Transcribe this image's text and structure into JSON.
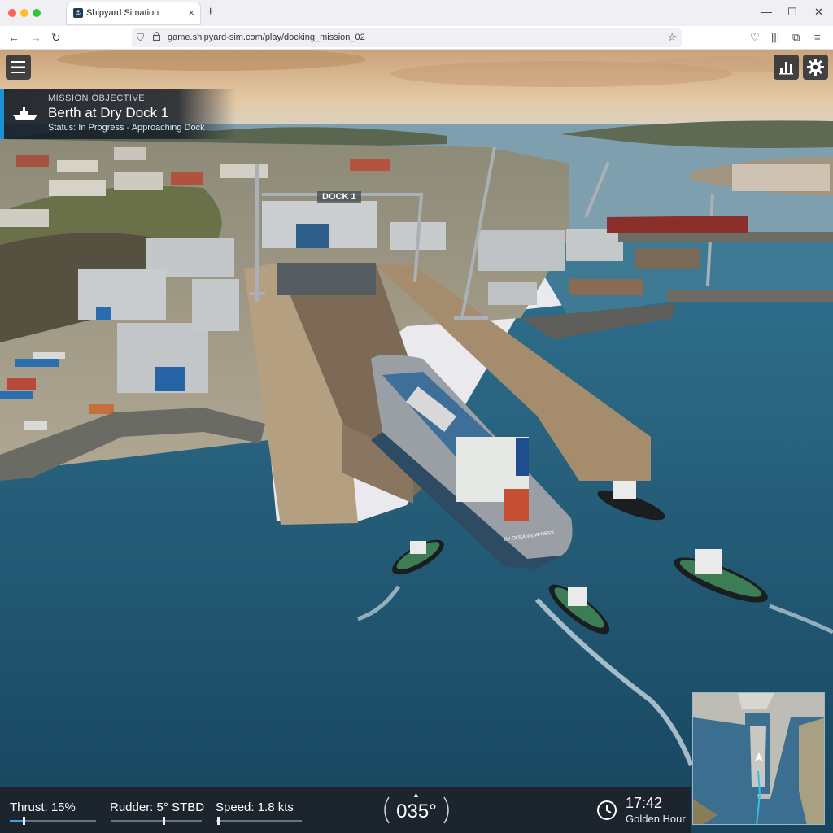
{
  "browser": {
    "tab_title": "Shipyard Simation",
    "url": "game.shipyard-sim.com/play/docking_mission_02"
  },
  "mission": {
    "label": "MISSION OBJECTIVE",
    "title": "Berth at Dry Dock 1",
    "status": "Status: In Progress - Approaching Dock"
  },
  "scene": {
    "dock_sign": "DOCK 1",
    "ship_name": "BY OCEAN EMPRESS"
  },
  "hud": {
    "thrust_label": "Thrust: 15%",
    "thrust_level": 0.15,
    "rudder_label": "Rudder: 5° STBD",
    "rudder_degrees": 5,
    "speed_label": "Speed: 1.8 kts",
    "speed_level": 0.02,
    "heading": "035°",
    "time": "17:42",
    "time_of_day": "Golden Hour"
  },
  "icons": {
    "menu": "hamburger-icon",
    "stats": "bar-chart-icon",
    "settings": "gear-icon",
    "clock": "clock-icon",
    "mission": "ship-icon"
  },
  "colors": {
    "accent": "#1e90d6",
    "hud_bg": "#1c2026",
    "water": "#1f4f68"
  }
}
